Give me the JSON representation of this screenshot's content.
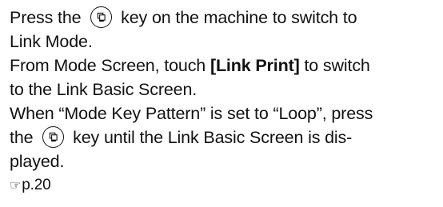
{
  "para1": {
    "before_key": "Press the",
    "after_key": "key on the machine to switch to",
    "line2": "Link Mode."
  },
  "para2": {
    "before_bold": "From Mode Screen, touch ",
    "bold": "[Link Print]",
    "after_bold": " to switch",
    "line2": "to the Link Basic Screen."
  },
  "para3": {
    "line1": "When “Mode Key Pattern” is set to “Loop”, press",
    "before_key": "the",
    "after_key": "key until the Link Basic Screen is dis-",
    "line3": "played."
  },
  "reference": {
    "icon": "pointing-hand-icon",
    "page": "p.20"
  }
}
